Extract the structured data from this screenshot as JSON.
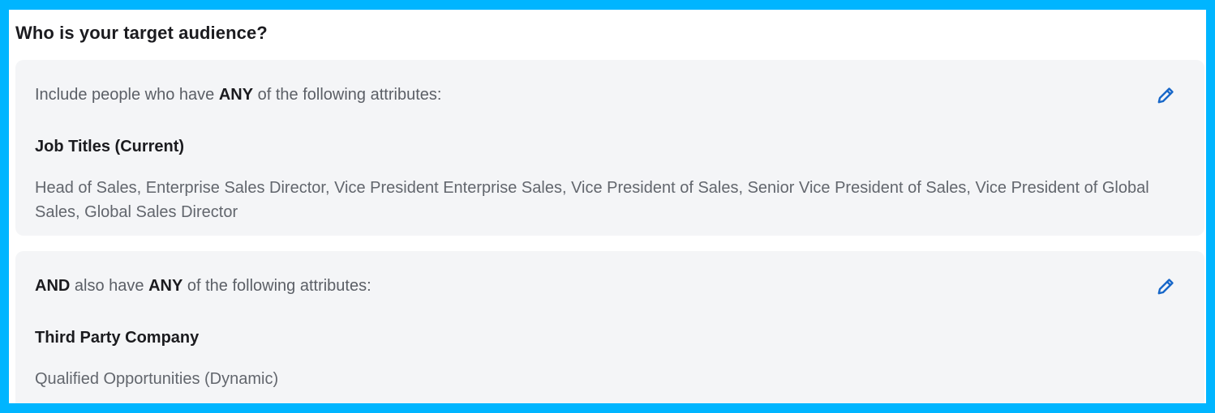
{
  "heading": "Who is your target audience?",
  "groups": [
    {
      "criteria_prefix": "",
      "criteria_lead": "Include people who have ",
      "criteria_any": "ANY",
      "criteria_tail": " of the following attributes:",
      "attribute_title": "Job Titles (Current)",
      "attribute_values": "Head of Sales, Enterprise Sales Director, Vice President Enterprise Sales, Vice President of Sales, Senior Vice President of Sales, Vice President of Global Sales, Global Sales Director",
      "edit_icon": "pencil-icon"
    },
    {
      "criteria_prefix": "AND",
      "criteria_lead": " also have ",
      "criteria_any": "ANY",
      "criteria_tail": " of the following attributes:",
      "attribute_title": "Third Party Company",
      "attribute_values": "Qualified Opportunities (Dynamic)",
      "edit_icon": "pencil-icon"
    }
  ],
  "colors": {
    "outer_border": "#00b5ff",
    "card_background": "#f4f5f7",
    "edit_icon": "#1767c9",
    "heading_text": "#1b1b1f",
    "body_text": "#5b5f66"
  }
}
